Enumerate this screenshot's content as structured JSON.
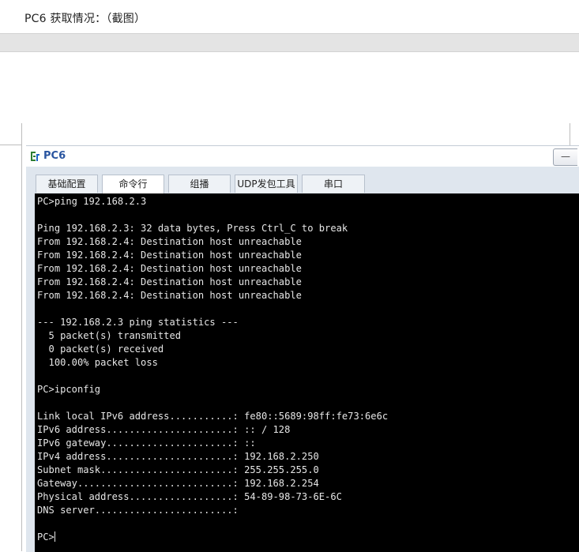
{
  "caption": "PC6 获取情况：（截图）",
  "window": {
    "title": "PC6",
    "minimize_label": "—"
  },
  "tabs": [
    {
      "label": "基础配置"
    },
    {
      "label": "命令行"
    },
    {
      "label": "组播"
    },
    {
      "label": "UDP发包工具"
    },
    {
      "label": "串口"
    }
  ],
  "terminal": {
    "lines": [
      "PC>ping 192.168.2.3",
      "",
      "Ping 192.168.2.3: 32 data bytes, Press Ctrl_C to break",
      "From 192.168.2.4: Destination host unreachable",
      "From 192.168.2.4: Destination host unreachable",
      "From 192.168.2.4: Destination host unreachable",
      "From 192.168.2.4: Destination host unreachable",
      "From 192.168.2.4: Destination host unreachable",
      "",
      "--- 192.168.2.3 ping statistics ---",
      "  5 packet(s) transmitted",
      "  0 packet(s) received",
      "  100.00% packet loss",
      "",
      "PC>ipconfig",
      "",
      "Link local IPv6 address...........: fe80::5689:98ff:fe73:6e6c",
      "IPv6 address......................: :: / 128",
      "IPv6 gateway......................: ::",
      "IPv4 address......................: 192.168.2.250",
      "Subnet mask.......................: 255.255.255.0",
      "Gateway...........................: 192.168.2.254",
      "Physical address..................: 54-89-98-73-6E-6C",
      "DNS server........................:",
      ""
    ],
    "prompt": "PC>"
  },
  "colors": {
    "terminal_bg": "#000000",
    "terminal_fg": "#e6e6e6",
    "title_blue": "#2a55a0",
    "window_bg": "#dfe6ee"
  },
  "icons": {
    "app": "ensp-pc-icon",
    "minimize": "minimize-icon"
  }
}
